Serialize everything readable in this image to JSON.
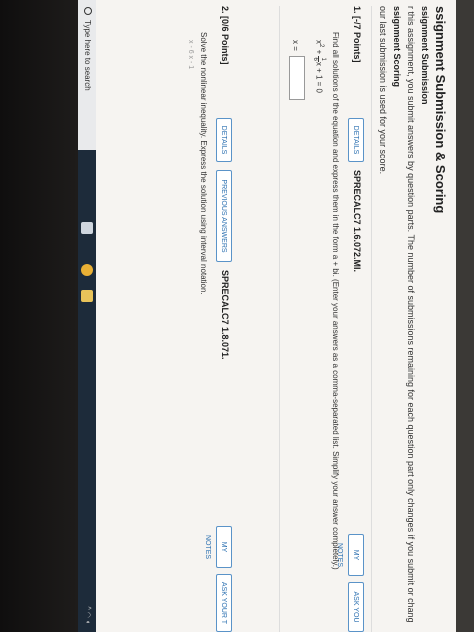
{
  "header": {
    "title": "ssignment Submission & Scoring",
    "submission_heading": "ssignment Submission",
    "submission_text": "r this assignment, you submit answers by question parts. The number of submissions remaining for each question part only changes if you submit or chang",
    "scoring_heading": "ssignment Scoring",
    "scoring_text": "our last submission is used for your score."
  },
  "questions": [
    {
      "number": "1.",
      "points": "[-/7 Points]",
      "details_label": "DETAILS",
      "code": "SPRECALC7 1.6.072.MI.",
      "my_notes_label": "MY NOTES",
      "ask_label": "ASK YOU",
      "prompt": "Find all solutions of the equation and express them in the form a + bi. (Enter your answers as a comma-separated list. Simplify your answer completely.)",
      "equation": {
        "lead": "x",
        "exponent": "2",
        "plus": "+",
        "frac_num": "1",
        "frac_den": "6",
        "var": "x",
        "rest": "+ 1 = 0"
      },
      "answer_label": "x =",
      "answer_value": ""
    },
    {
      "number": "2.",
      "points": "[0/6 Points]",
      "details_label": "DETAILS",
      "previous_label": "PREVIOUS ANSWERS",
      "code": "SPRECALC7 1.8.071.",
      "my_notes_label": "MY NOTES",
      "ask_label": "ASK YOUR T",
      "prompt": "Solve the nonlinear inequality. Express the solution using interval notation.",
      "partial": "x - 6   x - 1"
    }
  ],
  "taskbar": {
    "search_placeholder": "Type here to search"
  }
}
